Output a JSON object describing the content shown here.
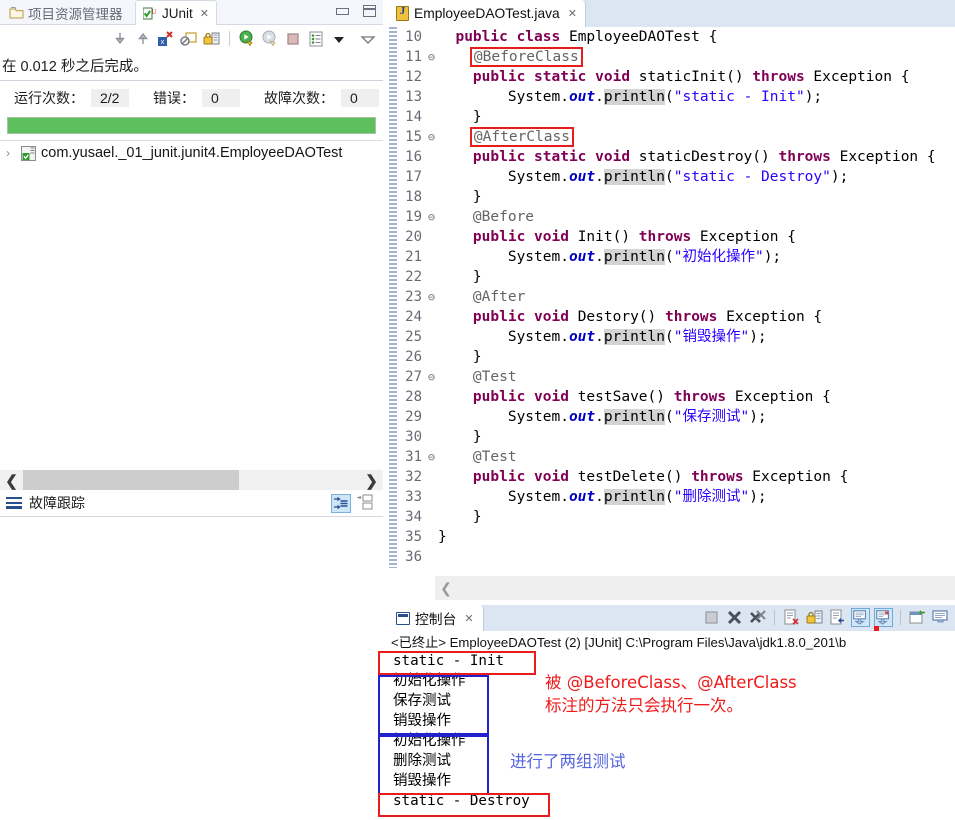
{
  "left_view": {
    "tabs": [
      {
        "label": "项目资源管理器",
        "icon": "package-explorer-icon",
        "active": false,
        "closeable": false
      },
      {
        "label": "JUnit",
        "icon": "junit-icon",
        "active": true,
        "closeable": true,
        "close_glyph": "✕"
      }
    ],
    "window_buttons": [
      {
        "name": "minimize-button",
        "glyph": "minimize"
      },
      {
        "name": "maximize-button",
        "glyph": "maximize"
      }
    ],
    "toolbar": [
      {
        "name": "next-failure-button",
        "icon": "arrow-down-icon"
      },
      {
        "name": "previous-failure-button",
        "icon": "arrow-up-icon"
      },
      {
        "name": "show-failures-only-button",
        "icon": "failures-filter-icon"
      },
      {
        "name": "show-ignored-button",
        "icon": "ignored-tests-icon"
      },
      {
        "name": "lock-scroll-button",
        "icon": "lock-icon"
      },
      {
        "name": "rerun-test-button",
        "icon": "rerun-icon"
      },
      {
        "name": "rerun-failed-button",
        "icon": "rerun-failed-icon"
      },
      {
        "name": "stop-button",
        "icon": "stop-icon"
      },
      {
        "name": "test-run-history-button",
        "icon": "history-list-icon"
      },
      {
        "name": "view-menu-button",
        "icon": "triangle-down-icon"
      },
      {
        "name": "minimize-view-button",
        "icon": "chevron-down-icon"
      }
    ],
    "summary": "在 0.012 秒之后完成。",
    "stats": [
      {
        "label": "运行次数：",
        "value": "2/2",
        "marker": "none"
      },
      {
        "label": "错误：",
        "value": "0",
        "marker": "red"
      },
      {
        "label": "故障次数：",
        "value": "0",
        "marker": "blue"
      }
    ],
    "progress": {
      "percent": 100,
      "color": "#5dc05d"
    },
    "tree": [
      {
        "expander": "›",
        "icon": "test-class-icon",
        "label": "com.yusael._01_junit.junit4.EmployeeDAOTest"
      }
    ],
    "hscroll": {
      "left_arrow": "❮",
      "right_arrow": "❯"
    },
    "failure_trace": {
      "label": "故障跟踪",
      "icon": "failure-trace-icon",
      "actions": [
        {
          "name": "filter-stack-trace-button",
          "icon": "filter-icon",
          "selected": true
        },
        {
          "name": "compare-result-button",
          "icon": "compare-icon",
          "selected": false
        }
      ]
    }
  },
  "editor": {
    "tab": {
      "label": "EmployeeDAOTest.java",
      "icon": "java-file-icon",
      "close_glyph": "✕"
    },
    "scroll_arrow": "❮",
    "lines": [
      {
        "no": "10",
        "fold": "",
        "segs": [
          {
            "t": "  ",
            "c": ""
          },
          {
            "t": "public class ",
            "c": "kw"
          },
          {
            "t": "EmployeeDAOTest {",
            "c": ""
          }
        ]
      },
      {
        "no": "11",
        "fold": "⊖",
        "segs": [
          {
            "t": "    ",
            "c": ""
          },
          {
            "t": "@BeforeClass",
            "c": "ann box"
          }
        ]
      },
      {
        "no": "12",
        "fold": "",
        "segs": [
          {
            "t": "    ",
            "c": ""
          },
          {
            "t": "public static void ",
            "c": "kw"
          },
          {
            "t": "staticInit() ",
            "c": ""
          },
          {
            "t": "throws ",
            "c": "kw"
          },
          {
            "t": "Exception {",
            "c": ""
          }
        ]
      },
      {
        "no": "13",
        "fold": "",
        "segs": [
          {
            "t": "        System.",
            "c": ""
          },
          {
            "t": "out",
            "c": "fld"
          },
          {
            "t": ".",
            "c": ""
          },
          {
            "t": "println",
            "c": "mth"
          },
          {
            "t": "(",
            "c": ""
          },
          {
            "t": "\"static - Init\"",
            "c": "str"
          },
          {
            "t": ");",
            "c": ""
          }
        ]
      },
      {
        "no": "14",
        "fold": "",
        "segs": [
          {
            "t": "    }",
            "c": ""
          }
        ]
      },
      {
        "no": "15",
        "fold": "⊖",
        "segs": [
          {
            "t": "    ",
            "c": ""
          },
          {
            "t": "@AfterClass",
            "c": "ann box"
          }
        ]
      },
      {
        "no": "16",
        "fold": "",
        "segs": [
          {
            "t": "    ",
            "c": ""
          },
          {
            "t": "public static void ",
            "c": "kw"
          },
          {
            "t": "staticDestroy() ",
            "c": ""
          },
          {
            "t": "throws ",
            "c": "kw"
          },
          {
            "t": "Exception {",
            "c": ""
          }
        ]
      },
      {
        "no": "17",
        "fold": "",
        "segs": [
          {
            "t": "        System.",
            "c": ""
          },
          {
            "t": "out",
            "c": "fld"
          },
          {
            "t": ".",
            "c": ""
          },
          {
            "t": "println",
            "c": "mth"
          },
          {
            "t": "(",
            "c": ""
          },
          {
            "t": "\"static - Destroy\"",
            "c": "str"
          },
          {
            "t": ");",
            "c": ""
          }
        ]
      },
      {
        "no": "18",
        "fold": "",
        "segs": [
          {
            "t": "    }",
            "c": ""
          }
        ]
      },
      {
        "no": "19",
        "fold": "⊖",
        "segs": [
          {
            "t": "    ",
            "c": ""
          },
          {
            "t": "@Before",
            "c": "ann"
          }
        ]
      },
      {
        "no": "20",
        "fold": "",
        "segs": [
          {
            "t": "    ",
            "c": ""
          },
          {
            "t": "public void ",
            "c": "kw"
          },
          {
            "t": "Init() ",
            "c": ""
          },
          {
            "t": "throws ",
            "c": "kw"
          },
          {
            "t": "Exception {",
            "c": ""
          }
        ]
      },
      {
        "no": "21",
        "fold": "",
        "segs": [
          {
            "t": "        System.",
            "c": ""
          },
          {
            "t": "out",
            "c": "fld"
          },
          {
            "t": ".",
            "c": ""
          },
          {
            "t": "println",
            "c": "mth"
          },
          {
            "t": "(",
            "c": ""
          },
          {
            "t": "\"初始化操作\"",
            "c": "str"
          },
          {
            "t": ");",
            "c": ""
          }
        ]
      },
      {
        "no": "22",
        "fold": "",
        "segs": [
          {
            "t": "    }",
            "c": ""
          }
        ]
      },
      {
        "no": "23",
        "fold": "⊖",
        "segs": [
          {
            "t": "    ",
            "c": ""
          },
          {
            "t": "@After",
            "c": "ann"
          }
        ]
      },
      {
        "no": "24",
        "fold": "",
        "segs": [
          {
            "t": "    ",
            "c": ""
          },
          {
            "t": "public void ",
            "c": "kw"
          },
          {
            "t": "Destory() ",
            "c": ""
          },
          {
            "t": "throws ",
            "c": "kw"
          },
          {
            "t": "Exception {",
            "c": ""
          }
        ]
      },
      {
        "no": "25",
        "fold": "",
        "segs": [
          {
            "t": "        System.",
            "c": ""
          },
          {
            "t": "out",
            "c": "fld"
          },
          {
            "t": ".",
            "c": ""
          },
          {
            "t": "println",
            "c": "mth"
          },
          {
            "t": "(",
            "c": ""
          },
          {
            "t": "\"销毁操作\"",
            "c": "str"
          },
          {
            "t": ");",
            "c": ""
          }
        ]
      },
      {
        "no": "26",
        "fold": "",
        "segs": [
          {
            "t": "    }",
            "c": ""
          }
        ]
      },
      {
        "no": "27",
        "fold": "⊖",
        "segs": [
          {
            "t": "    ",
            "c": ""
          },
          {
            "t": "@Test",
            "c": "ann"
          }
        ]
      },
      {
        "no": "28",
        "fold": "",
        "segs": [
          {
            "t": "    ",
            "c": ""
          },
          {
            "t": "public void ",
            "c": "kw"
          },
          {
            "t": "testSave() ",
            "c": ""
          },
          {
            "t": "throws ",
            "c": "kw"
          },
          {
            "t": "Exception {",
            "c": ""
          }
        ]
      },
      {
        "no": "29",
        "fold": "",
        "segs": [
          {
            "t": "        System.",
            "c": ""
          },
          {
            "t": "out",
            "c": "fld"
          },
          {
            "t": ".",
            "c": ""
          },
          {
            "t": "println",
            "c": "mth"
          },
          {
            "t": "(",
            "c": ""
          },
          {
            "t": "\"保存测试\"",
            "c": "str"
          },
          {
            "t": ");",
            "c": ""
          }
        ]
      },
      {
        "no": "30",
        "fold": "",
        "segs": [
          {
            "t": "    }",
            "c": ""
          }
        ]
      },
      {
        "no": "31",
        "fold": "⊖",
        "segs": [
          {
            "t": "    ",
            "c": ""
          },
          {
            "t": "@Test",
            "c": "ann"
          }
        ]
      },
      {
        "no": "32",
        "fold": "",
        "segs": [
          {
            "t": "    ",
            "c": ""
          },
          {
            "t": "public void ",
            "c": "kw"
          },
          {
            "t": "testDelete() ",
            "c": ""
          },
          {
            "t": "throws ",
            "c": "kw"
          },
          {
            "t": "Exception {",
            "c": ""
          }
        ]
      },
      {
        "no": "33",
        "fold": "",
        "segs": [
          {
            "t": "        System.",
            "c": ""
          },
          {
            "t": "out",
            "c": "fld"
          },
          {
            "t": ".",
            "c": ""
          },
          {
            "t": "println",
            "c": "mth"
          },
          {
            "t": "(",
            "c": ""
          },
          {
            "t": "\"删除测试\"",
            "c": "str"
          },
          {
            "t": ");",
            "c": ""
          }
        ]
      },
      {
        "no": "34",
        "fold": "",
        "segs": [
          {
            "t": "    }",
            "c": ""
          }
        ]
      },
      {
        "no": "35",
        "fold": "",
        "segs": [
          {
            "t": "}",
            "c": ""
          }
        ]
      },
      {
        "no": "36",
        "fold": "",
        "segs": [
          {
            "t": "",
            "c": ""
          }
        ]
      }
    ]
  },
  "console": {
    "tab": {
      "label": "控制台",
      "icon": "console-icon",
      "close_glyph": "✕"
    },
    "toolbar": [
      {
        "name": "terminate-button",
        "icon": "stop-icon",
        "selected": false
      },
      {
        "name": "remove-launch-button",
        "icon": "remove-x-icon",
        "selected": false
      },
      {
        "name": "remove-all-terminated-button",
        "icon": "remove-all-x-icon",
        "selected": false
      },
      {
        "name": "clear-console-button",
        "icon": "clear-console-icon",
        "selected": false
      },
      {
        "name": "scroll-lock-button",
        "icon": "lock-icon",
        "selected": false
      },
      {
        "name": "word-wrap-button",
        "icon": "word-wrap-icon",
        "selected": false
      },
      {
        "name": "show-console-on-output-button",
        "icon": "console-output-icon",
        "selected": true
      },
      {
        "name": "show-console-on-error-button",
        "icon": "console-error-icon",
        "selected": true
      },
      {
        "name": "pin-console-button",
        "icon": "pin-icon",
        "selected": false
      },
      {
        "name": "display-selected-console-button",
        "icon": "display-console-icon",
        "selected": false
      }
    ],
    "process_line": "<已终止> EmployeeDAOTest  (2)   [JUnit] C:\\Program Files\\Java\\jdk1.8.0_201\\b",
    "output": [
      "static - Init",
      "初始化操作",
      "保存测试",
      "销毁操作",
      "初始化操作",
      "删除测试",
      "销毁操作",
      "static - Destroy"
    ],
    "annotations": [
      {
        "name": "annotation-note-red",
        "text": "被 @BeforeClass、@AfterClass\n标注的方法只会执行一次。",
        "color": "#f01a1a"
      },
      {
        "name": "annotation-note-blue",
        "text": "进行了两组测试",
        "color": "#5566dd"
      }
    ],
    "highlight_boxes": [
      {
        "name": "highlight-static-init",
        "color": "#e81c1c"
      },
      {
        "name": "highlight-first-test-group",
        "color": "#2222cc"
      },
      {
        "name": "highlight-second-test-group",
        "color": "#2222cc"
      },
      {
        "name": "highlight-static-destroy",
        "color": "#e81c1c"
      }
    ]
  }
}
